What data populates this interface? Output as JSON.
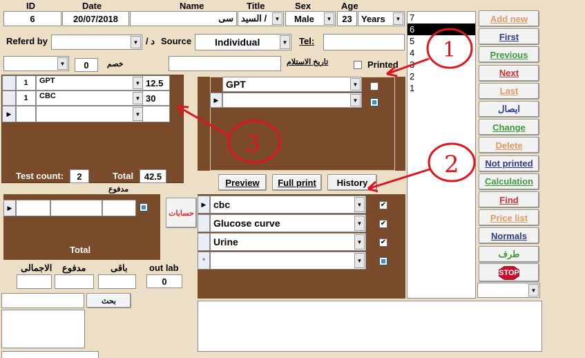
{
  "header": {
    "id_label": "ID",
    "date_label": "Date",
    "name_label": "Name",
    "title_label": "Title",
    "sex_label": "Sex",
    "age_label": "Age"
  },
  "patient": {
    "id": "6",
    "date": "20/07/2018",
    "name": "سى",
    "title": "السيد /",
    "sex": "Male",
    "age": "23",
    "age_unit": "Years"
  },
  "referral": {
    "referd_label": "Referd by",
    "referd_value": "",
    "doctor_prefix": "/ د",
    "source_label": "Source",
    "source_value": "Individual",
    "tel_label": "Tel:",
    "tel_value": ""
  },
  "discount": {
    "value": "0",
    "label": "خصم"
  },
  "receipt": {
    "label": "تاريخ الاستلام",
    "value": "",
    "printed_label": "Printed",
    "printed_checked": false
  },
  "tests_table": {
    "rows": [
      {
        "qty": "1",
        "name": "GPT",
        "price": "12.5"
      },
      {
        "qty": "1",
        "name": "CBC",
        "price": "30"
      }
    ],
    "test_count_label": "Test count:",
    "test_count": "2",
    "total_label": "Total",
    "total": "42.5"
  },
  "payments": {
    "title": "مدفوع",
    "total_label": "Total",
    "accounts_button": "حسابات"
  },
  "summary": {
    "total_label": "الاجمالى",
    "paid_label": "مدفوع",
    "remaining_label": "باقى",
    "outlab_label": "out lab",
    "outlab_value": "0"
  },
  "search": {
    "button": "بحث"
  },
  "selected_test": {
    "name": "GPT"
  },
  "actions": {
    "preview": "Preview",
    "full_print": "Full print",
    "history": "History"
  },
  "subtests": [
    {
      "name": "cbc",
      "checked": true
    },
    {
      "name": "Glucose curve",
      "checked": true
    },
    {
      "name": "Urine",
      "checked": true
    }
  ],
  "id_list": {
    "items": [
      "7",
      "6",
      "5",
      "4",
      "3",
      "2",
      "1"
    ],
    "selected": "6"
  },
  "nav_buttons": [
    {
      "key": "add_new",
      "label": "Add new",
      "color": "#e39a5f"
    },
    {
      "key": "first",
      "label": "First",
      "color": "#2b3a8f"
    },
    {
      "key": "previous",
      "label": "Previous",
      "color": "#3a9b3a"
    },
    {
      "key": "next",
      "label": "Next",
      "color": "#d62c2c"
    },
    {
      "key": "last",
      "label": "Last",
      "color": "#e39a5f"
    },
    {
      "key": "receipt",
      "label": "ايصال",
      "color": "#2b3a8f"
    },
    {
      "key": "change",
      "label": "Change",
      "color": "#3a9b3a"
    },
    {
      "key": "delete",
      "label": "Delete",
      "color": "#e39a5f"
    },
    {
      "key": "not_printed",
      "label": "Not printed ",
      "color": "#2b3a8f"
    },
    {
      "key": "calculation",
      "label": "Calculation",
      "color": "#3a9b3a"
    },
    {
      "key": "find",
      "label": "Find",
      "color": "#d62c2c"
    },
    {
      "key": "price_list",
      "label": "Price list",
      "color": "#e39a5f"
    },
    {
      "key": "normals",
      "label": "Normals",
      "color": "#2b3a8f"
    },
    {
      "key": "side",
      "label": "طرف",
      "color": "#3a9b3a"
    }
  ],
  "stop_button": {
    "label": "STOP",
    "color": "#c8102e"
  },
  "annotations": {
    "a1": "1",
    "a2": "2",
    "a3": "3",
    "color": "#e0151b"
  }
}
